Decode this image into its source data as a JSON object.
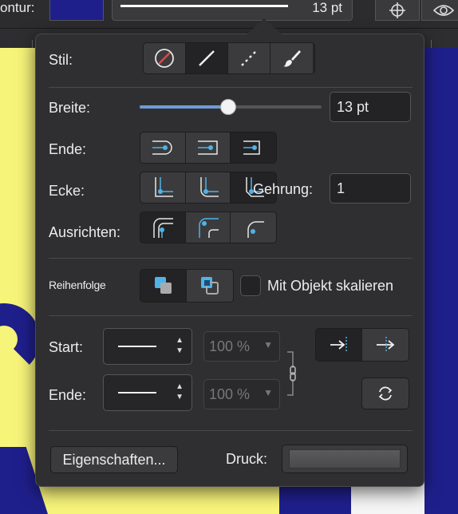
{
  "toolbar": {
    "kontur_label": "ontur:",
    "stroke_value": "13 pt",
    "swatch_color": "#1f1f8c",
    "crosshair_icon": "crosshair-icon",
    "eye_icon": "eye-icon"
  },
  "popover": {
    "stil_label": "Stil:",
    "stil_options": [
      "none-style",
      "solid-line",
      "dashed-line",
      "brush"
    ],
    "stil_selected": 1,
    "breite_label": "Breite:",
    "breite_value": "13 pt",
    "breite_fraction": 0.49,
    "ende_label": "Ende:",
    "ende_options": [
      "butt-cap",
      "round-cap",
      "square-cap"
    ],
    "ende_selected": 2,
    "ecke_label": "Ecke:",
    "ecke_options": [
      "miter-join",
      "round-join",
      "bevel-join"
    ],
    "ecke_selected": 2,
    "gehrung_label": "Gehrung:",
    "gehrung_value": "1",
    "ausrichten_label": "Ausrichten:",
    "ausrichten_options": [
      "align-inside",
      "align-center",
      "align-outside"
    ],
    "ausrichten_selected": 0,
    "reihenfolge_label": "Reihenfolge",
    "reihenfolge_options": [
      "stroke-behind",
      "stroke-front"
    ],
    "reihenfolge_selected": 0,
    "skalieren_label": "Mit Objekt skalieren",
    "skalieren_checked": false,
    "start_label": "Start:",
    "start_pct": "100 %",
    "ende2_label": "Ende:",
    "ende2_pct": "100 %",
    "arrow_pos_options": [
      "arrow-inside",
      "arrow-outside"
    ],
    "arrow_pos_selected": 0,
    "eigenschaften_label": "Eigenschaften...",
    "druck_label": "Druck:"
  },
  "colors": {
    "accent": "#6f9ad6",
    "node": "#4fb3e8",
    "canvas_yellow": "#f7f47a",
    "canvas_blue": "#1f1f8c"
  }
}
